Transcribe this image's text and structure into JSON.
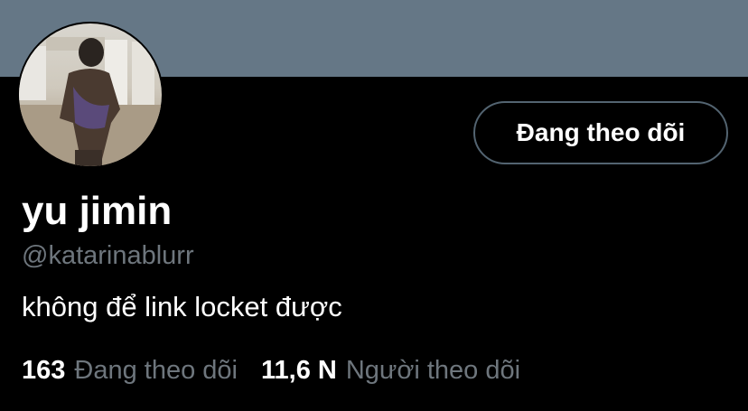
{
  "profile": {
    "display_name": "yu jimin",
    "handle": "@katarinablurr",
    "bio": "không để link locket được",
    "follow_button_label": "Đang theo dõi",
    "avatar_icon": "profile-photo",
    "banner_color": "#657786"
  },
  "stats": {
    "following_count": "163",
    "following_label": "Đang theo dõi",
    "followers_count": "11,6 N",
    "followers_label": "Người theo dõi"
  }
}
